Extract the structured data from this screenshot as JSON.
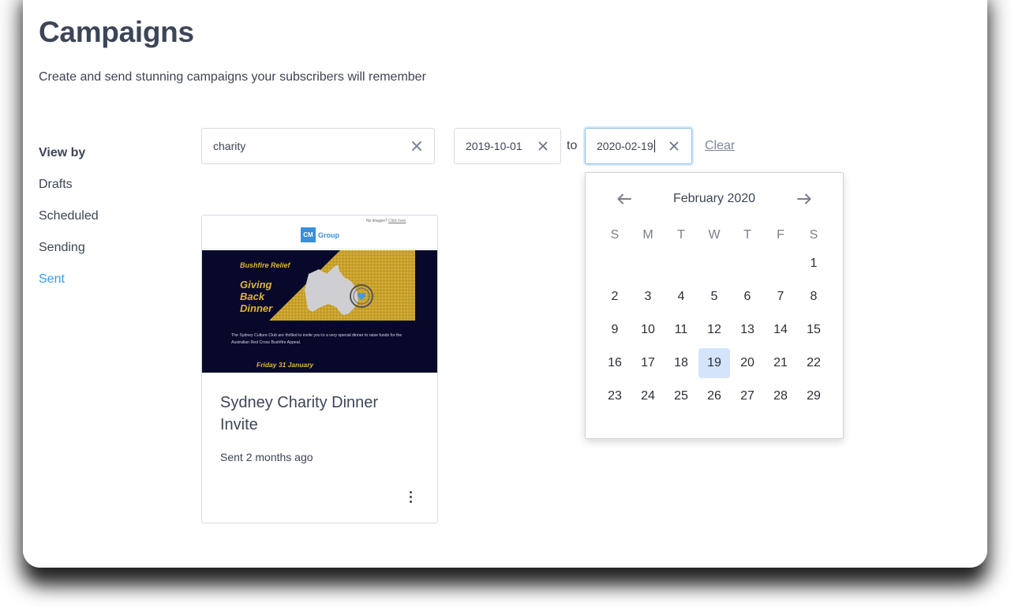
{
  "page": {
    "title": "Campaigns",
    "subtitle": "Create and send stunning campaigns your subscribers will remember"
  },
  "sidebar": {
    "heading": "View by",
    "items": [
      {
        "label": "Drafts",
        "active": false
      },
      {
        "label": "Scheduled",
        "active": false
      },
      {
        "label": "Sending",
        "active": false
      },
      {
        "label": "Sent",
        "active": true
      }
    ]
  },
  "filters": {
    "search_value": "charity",
    "date_from": "2019-10-01",
    "to_label": "to",
    "date_to": "2020-02-19",
    "clear_label": "Clear"
  },
  "campaigns": [
    {
      "title": "Sydney Charity Dinner Invite",
      "meta": "Sent 2 months ago",
      "thumbnail": {
        "no_images_text": "No images?",
        "click_here": "Click here",
        "logo_box": "CM",
        "logo_word": "Group",
        "kicker": "Bushfire Relief",
        "headline_lines": [
          "Giving",
          "Back",
          "Dinner"
        ],
        "paragraph": "The Sydney Culture Club are thrilled to invite you to a very special dinner to raise funds for the Australian Red Cross Bushfire Appeal.",
        "date": "Friday 31 January"
      }
    }
  ],
  "datepicker": {
    "month_label": "February 2020",
    "weekdays": [
      "S",
      "M",
      "T",
      "W",
      "T",
      "F",
      "S"
    ],
    "weeks": [
      [
        "",
        "",
        "",
        "",
        "",
        "",
        "1"
      ],
      [
        "2",
        "3",
        "4",
        "5",
        "6",
        "7",
        "8"
      ],
      [
        "9",
        "10",
        "11",
        "12",
        "13",
        "14",
        "15"
      ],
      [
        "16",
        "17",
        "18",
        "19",
        "20",
        "21",
        "22"
      ],
      [
        "23",
        "24",
        "25",
        "26",
        "27",
        "28",
        "29"
      ]
    ],
    "selected_day": "19"
  },
  "colors": {
    "accent": "#3a9ae8",
    "selected_day_bg": "#d3e4fb",
    "banner_bg": "#07082a",
    "banner_gold": "#e0b53a"
  }
}
